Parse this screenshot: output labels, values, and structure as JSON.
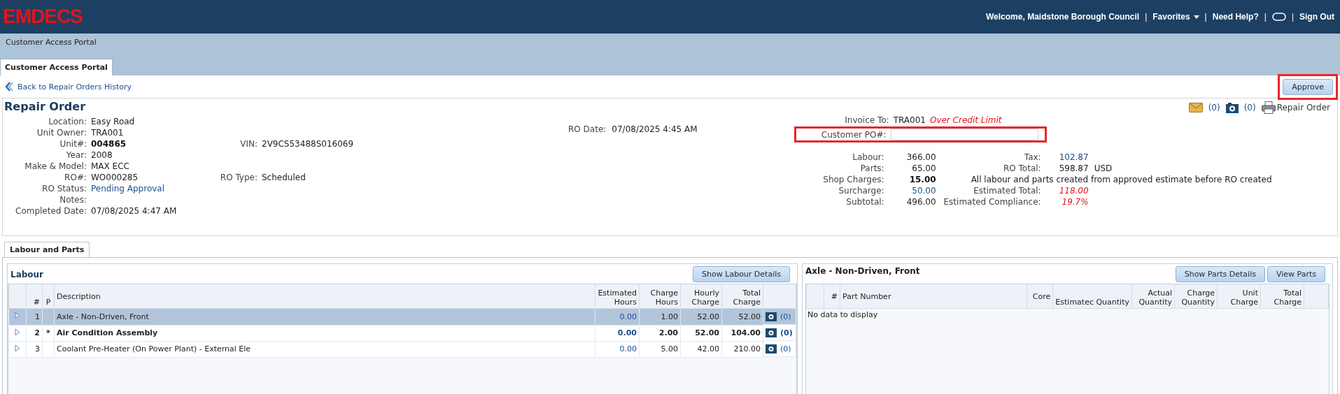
{
  "header": {
    "logo": "EMDECS",
    "welcome": "Welcome, Maidstone Borough Council",
    "favorites": "Favorites",
    "help": "Need Help?",
    "sign_out": "Sign Out",
    "separators": [
      "|",
      "|",
      "|",
      "|"
    ]
  },
  "portal_title": "Customer Access Portal",
  "tabs": [
    {
      "label": "Customer Access Portal",
      "selected": true
    }
  ],
  "back_link": "Back to Repair Orders History",
  "approve_button": {
    "label": "Approve",
    "highlighted": true
  },
  "repair_order": {
    "title": "Repair Order",
    "toolbar": [
      {
        "kind": "mail",
        "count": "(0)"
      },
      {
        "kind": "camera",
        "count": "(0)"
      },
      {
        "kind": "print",
        "label": "Repair Order"
      }
    ],
    "fields": [
      {
        "label": "Location:",
        "value": "Easy Road",
        "kind": "plain"
      },
      {
        "label": "Unit Owner:",
        "value": "TRA001",
        "kind": "plain"
      },
      {
        "label": "Unit#:",
        "value": "004865",
        "kind": "bold",
        "side": {
          "label": "VIN:",
          "value": "2V9CS53488S016069"
        }
      },
      {
        "label": "Year:",
        "value": "2008",
        "kind": "plain"
      },
      {
        "label": "Make & Model:",
        "value": "MAX ECC",
        "kind": "plain"
      },
      {
        "label": "RO#:",
        "value": "WO000285",
        "kind": "plain",
        "side": {
          "label": "RO Type:",
          "value": "Scheduled"
        }
      },
      {
        "label": "RO Status:",
        "value": "Pending Approval",
        "kind": "link"
      },
      {
        "label": "Notes:"
      },
      {
        "label": "Completed Date:",
        "value": "07/08/2025 4:47 AM",
        "kind": "plain"
      }
    ],
    "ro_date": {
      "label": "RO Date:",
      "value": "07/08/2025 4:45 AM"
    },
    "invoice_to": {
      "label": "Invoice To:",
      "value": "TRA001",
      "note": "Over Credit Limit"
    },
    "customer_po": {
      "label": "Customer PO#:",
      "highlighted": true
    },
    "totals": [
      {
        "label": "Labour:",
        "value": "366.00",
        "kind": "plain"
      },
      {
        "label": "Parts:",
        "value": "65.00",
        "kind": "plain"
      },
      {
        "label": "Shop Charges:",
        "value": "15.00",
        "kind": "bold"
      },
      {
        "label": "Surcharge:",
        "value": "50.00",
        "kind": "link"
      },
      {
        "label": "Subtotal:",
        "value": "496.00",
        "kind": "plain"
      }
    ],
    "summary": [
      {
        "kind": "link",
        "label": "Tax:",
        "value": "102.87"
      },
      {
        "kind": "plain",
        "label": "RO Total:",
        "value": "598.87",
        "unit": "USD"
      },
      {
        "kind": "note",
        "text": "All labour and parts created from approved estimate before RO created"
      },
      {
        "kind": "alert",
        "label": "Estimated Total:",
        "value": "118.00"
      },
      {
        "kind": "alert",
        "label": "Estimated Compliance:",
        "value": "19.7%"
      }
    ]
  },
  "section_tabs": [
    {
      "label": "Labour and Parts",
      "selected": true
    }
  ],
  "labour": {
    "title": "Labour",
    "button": "Show Labour Details",
    "columns": [
      "#",
      "P",
      "Description",
      "Estimated Hours",
      "Charge Hours",
      "Hourly Charge",
      "Total Charge"
    ],
    "rows": [
      {
        "num": "1",
        "p": "",
        "description": "Axle - Non-Driven, Front",
        "est": "0.00",
        "charge_hours": "1.00",
        "hourly": "52.00",
        "total": "52.00",
        "attachments": "(0)",
        "selected": true,
        "bold": false
      },
      {
        "num": "2",
        "p": "*",
        "description": "Air Condition Assembly",
        "est": "0.00",
        "charge_hours": "2.00",
        "hourly": "52.00",
        "total": "104.00",
        "attachments": "(0)",
        "selected": false,
        "bold": true
      },
      {
        "num": "3",
        "p": "",
        "description": "Coolant Pre-Heater (On Power Plant) - External Ele",
        "est": "0.00",
        "charge_hours": "5.00",
        "hourly": "42.00",
        "total": "210.00",
        "attachments": "(0)",
        "selected": false,
        "bold": false
      }
    ]
  },
  "parts": {
    "title": "Axle - Non-Driven, Front",
    "buttons": [
      "Show Parts Details",
      "View Parts"
    ],
    "columns": [
      "#",
      "Part Number",
      "Core",
      "Estimatec Quantity",
      "Actual Quantity",
      "Charge Quantity",
      "Unit Charge",
      "Total Charge"
    ],
    "empty_text": "No data to display"
  }
}
